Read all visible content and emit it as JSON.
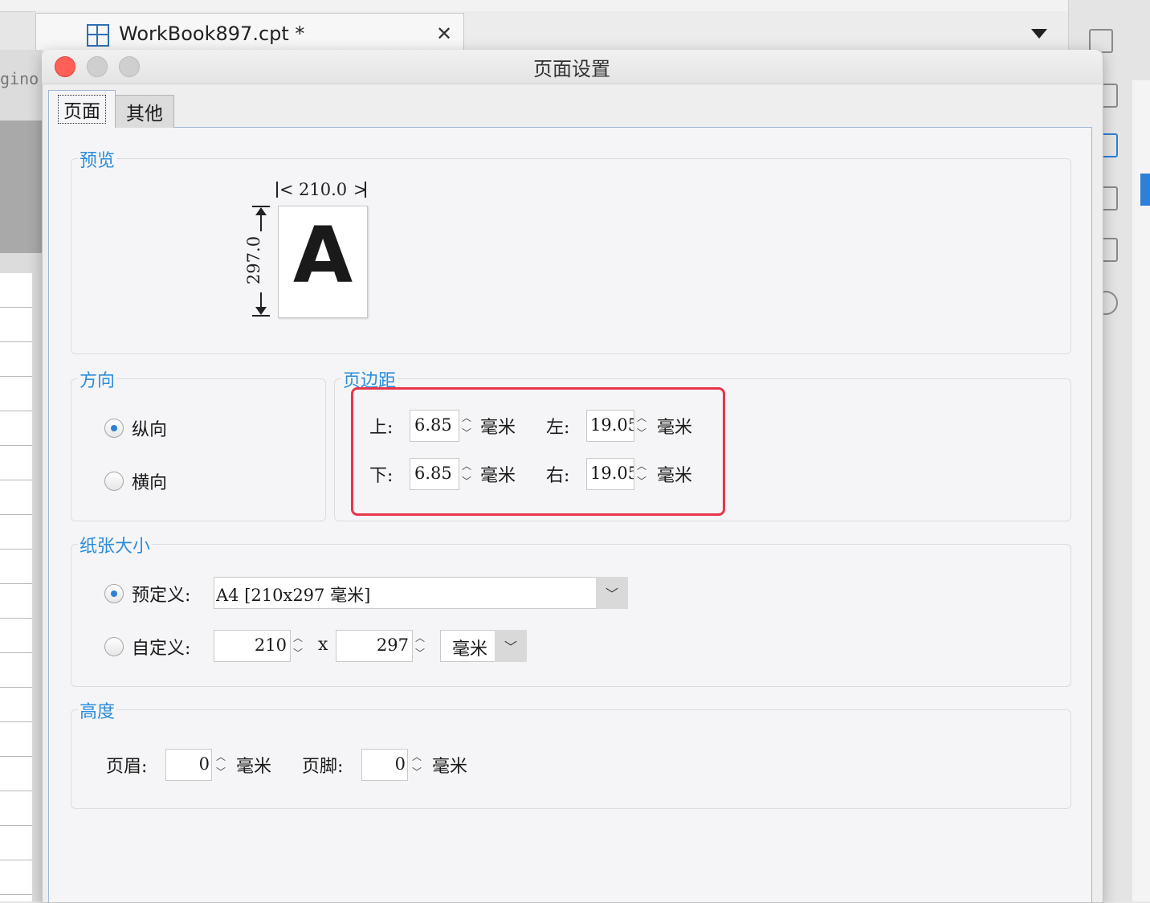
{
  "background": {
    "doc_tab_title": "WorkBook897.cpt *",
    "doc_tab_close": "✕",
    "side_text": "gino"
  },
  "dialog": {
    "title": "页面设置",
    "tabs": [
      {
        "label": "页面",
        "active": true
      },
      {
        "label": "其他",
        "active": false
      }
    ]
  },
  "preview": {
    "title": "预览",
    "width_label": "210.0",
    "height_label": "297.0",
    "letter": "A"
  },
  "orientation": {
    "title": "方向",
    "options": [
      {
        "label": "纵向",
        "selected": true
      },
      {
        "label": "横向",
        "selected": false
      }
    ]
  },
  "margins": {
    "title": "页边距",
    "top": {
      "label": "上:",
      "value": "6.85",
      "unit": "毫米"
    },
    "bottom": {
      "label": "下:",
      "value": "6.85",
      "unit": "毫米"
    },
    "left": {
      "label": "左:",
      "value": "19.05",
      "unit": "毫米"
    },
    "right": {
      "label": "右:",
      "value": "19.05",
      "unit": "毫米"
    },
    "highlight_color": "#e8354a"
  },
  "paper": {
    "title": "纸张大小",
    "predefined_label": "预定义:",
    "predefined_value": "A4 [210x297 毫米]",
    "custom_label": "自定义:",
    "custom_width": "210",
    "custom_height": "297",
    "times": "x",
    "unit": "毫米",
    "predefined_selected": true
  },
  "height": {
    "title": "高度",
    "header_label": "页眉:",
    "header_value": "0",
    "footer_label": "页脚:",
    "footer_value": "0",
    "unit": "毫米"
  },
  "colors": {
    "accent": "#2b8ddb",
    "close_light": "#fe5f57",
    "inactive_light": "#cfcfcf"
  }
}
